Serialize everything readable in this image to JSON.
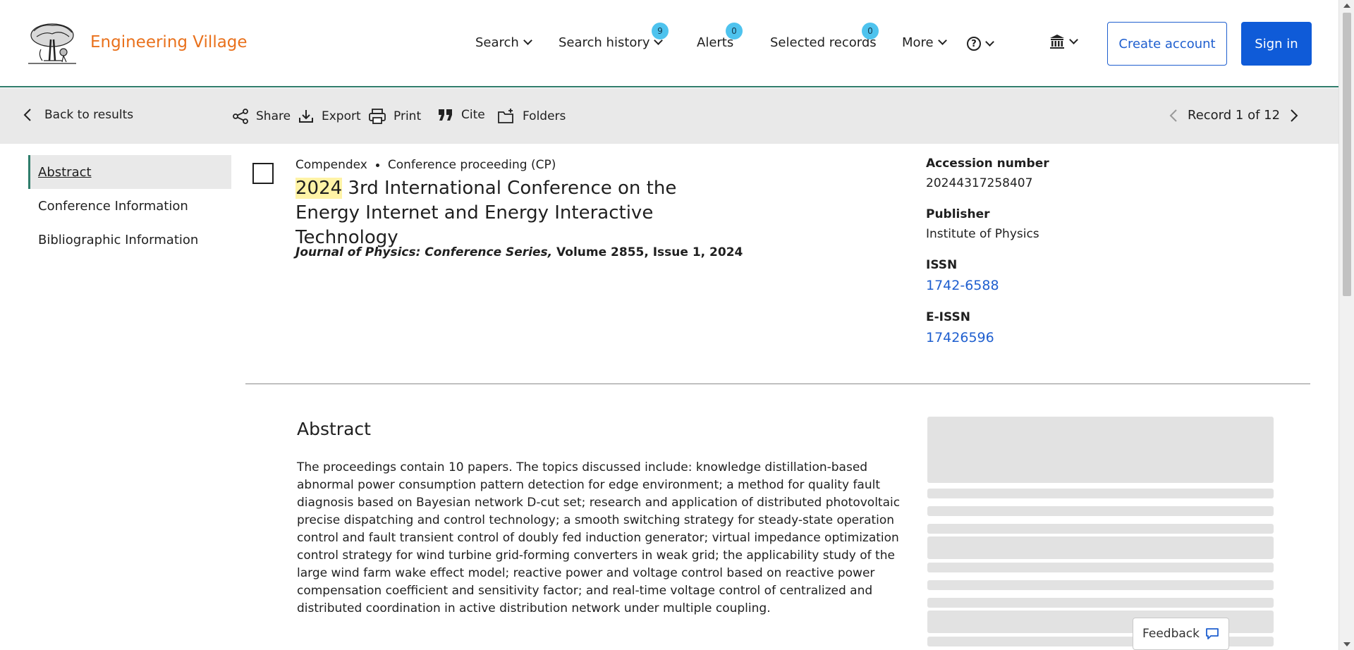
{
  "brand": {
    "name": "Engineering Village"
  },
  "nav": {
    "search": "Search",
    "search_history": "Search history",
    "search_history_count": "9",
    "alerts": "Alerts",
    "alerts_count": "0",
    "selected_records": "Selected records",
    "selected_records_count": "0",
    "more": "More",
    "help_icon_glyph": "?"
  },
  "auth": {
    "create_account": "Create account",
    "sign_in": "Sign in"
  },
  "toolbar": {
    "back": "Back to results",
    "share": "Share",
    "export": "Export",
    "print": "Print",
    "cite": "Cite",
    "folders": "Folders",
    "record_counter": "Record 1 of 12"
  },
  "sidebar": {
    "items": [
      {
        "label": "Abstract",
        "active": true
      },
      {
        "label": "Conference Information",
        "active": false
      },
      {
        "label": "Bibliographic Information",
        "active": false
      }
    ]
  },
  "record": {
    "database": "Compendex",
    "doc_type": "Conference proceeding (CP)",
    "title_highlight": "2024",
    "title_rest": " 3rd International Conference on the Energy Internet and Energy Interactive Technology",
    "source_journal": "Journal of Physics: Conference Series,",
    "source_details": " Volume 2855, Issue 1, 2024"
  },
  "details": {
    "accession_label": "Accession number",
    "accession_value": "20244317258407",
    "publisher_label": "Publisher",
    "publisher_value": "Institute of Physics",
    "issn_label": "ISSN",
    "issn_value": "1742-6588",
    "eissn_label": "E-ISSN",
    "eissn_value": "17426596"
  },
  "abstract": {
    "heading": "Abstract",
    "text": "The proceedings contain 10 papers. The topics discussed include: knowledge distillation-based abnormal power consumption pattern detection for edge environment; a method for quality fault diagnosis based on Bayesian network D-cut set; research and application of distributed photovoltaic precise dispatching and control technology; a smooth switching strategy for steady-state operation control and fault transient control of doubly fed induction generator; virtual impedance optimization control strategy for wind turbine grid-forming converters in weak grid; the applicability study of the large wind farm wake effect model; reactive power and voltage control based on reactive power compensation coefficient and sensitivity factor; and real-time voltage control of centralized and distributed coordination in active distribution network under multiple coupling."
  },
  "feedback": {
    "label": "Feedback"
  },
  "colors": {
    "brand": "#e9711c",
    "primary": "#0f5bd8",
    "link": "#1f5fcf",
    "accent_green": "#2f7d6b",
    "badge": "#4ec3ee",
    "highlight": "#fff3a6"
  }
}
